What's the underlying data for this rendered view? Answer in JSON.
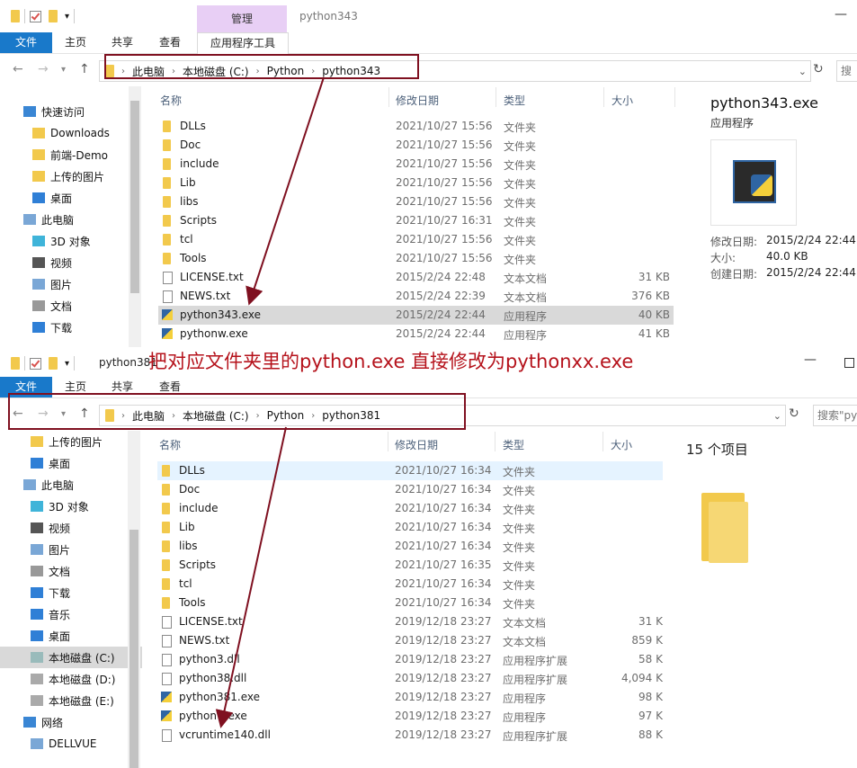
{
  "window1": {
    "title": "python343",
    "manage_tab": "管理",
    "tabs": [
      "文件",
      "主页",
      "共享",
      "查看",
      "应用程序工具"
    ],
    "breadcrumb": [
      "此电脑",
      "本地磁盘 (C:)",
      "Python",
      "python343"
    ],
    "search_placeholder": "搜",
    "nav": [
      "快速访问",
      "Downloads",
      "前端-Demo",
      "上传的图片",
      "桌面",
      "此电脑",
      "3D 对象",
      "视频",
      "图片",
      "文档",
      "下载"
    ],
    "columns": {
      "name": "名称",
      "date": "修改日期",
      "type": "类型",
      "size": "大小"
    },
    "files": [
      {
        "name": "DLLs",
        "date": "2021/10/27 15:56",
        "type": "文件夹",
        "size": "",
        "icon": "folder"
      },
      {
        "name": "Doc",
        "date": "2021/10/27 15:56",
        "type": "文件夹",
        "size": "",
        "icon": "folder"
      },
      {
        "name": "include",
        "date": "2021/10/27 15:56",
        "type": "文件夹",
        "size": "",
        "icon": "folder"
      },
      {
        "name": "Lib",
        "date": "2021/10/27 15:56",
        "type": "文件夹",
        "size": "",
        "icon": "folder"
      },
      {
        "name": "libs",
        "date": "2021/10/27 15:56",
        "type": "文件夹",
        "size": "",
        "icon": "folder"
      },
      {
        "name": "Scripts",
        "date": "2021/10/27 16:31",
        "type": "文件夹",
        "size": "",
        "icon": "folder"
      },
      {
        "name": "tcl",
        "date": "2021/10/27 15:56",
        "type": "文件夹",
        "size": "",
        "icon": "folder"
      },
      {
        "name": "Tools",
        "date": "2021/10/27 15:56",
        "type": "文件夹",
        "size": "",
        "icon": "folder"
      },
      {
        "name": "LICENSE.txt",
        "date": "2015/2/24 22:48",
        "type": "文本文档",
        "size": "31 KB",
        "icon": "doc"
      },
      {
        "name": "NEWS.txt",
        "date": "2015/2/24 22:39",
        "type": "文本文档",
        "size": "376 KB",
        "icon": "doc"
      },
      {
        "name": "python343.exe",
        "date": "2015/2/24 22:44",
        "type": "应用程序",
        "size": "40 KB",
        "icon": "py",
        "selected": true
      },
      {
        "name": "pythonw.exe",
        "date": "2015/2/24 22:44",
        "type": "应用程序",
        "size": "41 KB",
        "icon": "py"
      }
    ],
    "details": {
      "name": "python343.exe",
      "kind": "应用程序",
      "labels": [
        "修改日期:",
        "大小:",
        "创建日期:"
      ],
      "values": [
        "2015/2/24 22:44",
        "40.0 KB",
        "2015/2/24 22:44"
      ]
    }
  },
  "window2": {
    "title": "python381",
    "tabs": [
      "文件",
      "主页",
      "共享",
      "查看"
    ],
    "breadcrumb": [
      "此电脑",
      "本地磁盘 (C:)",
      "Python",
      "python381"
    ],
    "search_placeholder": "搜索\"py",
    "nav": [
      "上传的图片",
      "桌面",
      "此电脑",
      "3D 对象",
      "视频",
      "图片",
      "文档",
      "下载",
      "音乐",
      "桌面",
      "本地磁盘 (C:)",
      "本地磁盘 (D:)",
      "本地磁盘 (E:)",
      "网络",
      "DELLVUE"
    ],
    "columns": {
      "name": "名称",
      "date": "修改日期",
      "type": "类型",
      "size": "大小"
    },
    "files": [
      {
        "name": "DLLs",
        "date": "2021/10/27 16:34",
        "type": "文件夹",
        "size": "",
        "icon": "folder",
        "hover": true
      },
      {
        "name": "Doc",
        "date": "2021/10/27 16:34",
        "type": "文件夹",
        "size": "",
        "icon": "folder"
      },
      {
        "name": "include",
        "date": "2021/10/27 16:34",
        "type": "文件夹",
        "size": "",
        "icon": "folder"
      },
      {
        "name": "Lib",
        "date": "2021/10/27 16:34",
        "type": "文件夹",
        "size": "",
        "icon": "folder"
      },
      {
        "name": "libs",
        "date": "2021/10/27 16:34",
        "type": "文件夹",
        "size": "",
        "icon": "folder"
      },
      {
        "name": "Scripts",
        "date": "2021/10/27 16:35",
        "type": "文件夹",
        "size": "",
        "icon": "folder"
      },
      {
        "name": "tcl",
        "date": "2021/10/27 16:34",
        "type": "文件夹",
        "size": "",
        "icon": "folder"
      },
      {
        "name": "Tools",
        "date": "2021/10/27 16:34",
        "type": "文件夹",
        "size": "",
        "icon": "folder"
      },
      {
        "name": "LICENSE.txt",
        "date": "2019/12/18 23:27",
        "type": "文本文档",
        "size": "31 K",
        "icon": "doc"
      },
      {
        "name": "NEWS.txt",
        "date": "2019/12/18 23:27",
        "type": "文本文档",
        "size": "859 K",
        "icon": "doc"
      },
      {
        "name": "python3.dll",
        "date": "2019/12/18 23:27",
        "type": "应用程序扩展",
        "size": "58 K",
        "icon": "dll"
      },
      {
        "name": "python38.dll",
        "date": "2019/12/18 23:27",
        "type": "应用程序扩展",
        "size": "4,094 K",
        "icon": "dll"
      },
      {
        "name": "python381.exe",
        "date": "2019/12/18 23:27",
        "type": "应用程序",
        "size": "98 K",
        "icon": "py"
      },
      {
        "name": "pythonw.exe",
        "date": "2019/12/18 23:27",
        "type": "应用程序",
        "size": "97 K",
        "icon": "py"
      },
      {
        "name": "vcruntime140.dll",
        "date": "2019/12/18 23:27",
        "type": "应用程序扩展",
        "size": "88 K",
        "icon": "dll"
      }
    ],
    "details": {
      "count": "15 个项目"
    }
  },
  "annotation": "把对应文件夹里的python.exe    直接修改为pythonxx.exe",
  "colors": {
    "accent": "#1979ca",
    "arrow": "#7f1020",
    "annotation": "#b5121b",
    "manage_tab": "#e8cff5"
  }
}
